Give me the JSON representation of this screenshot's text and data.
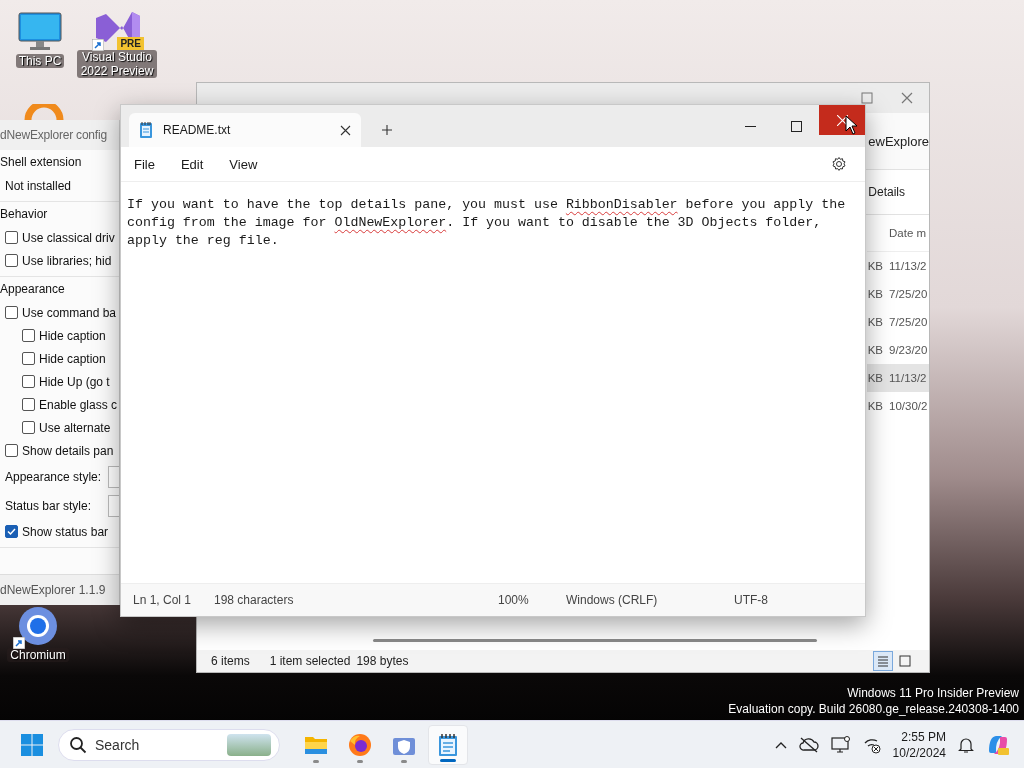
{
  "desktop_icons": [
    {
      "kind": "monitor",
      "label": "This PC",
      "shortcut": false
    },
    {
      "kind": "visual-studio",
      "label": "Visual Studio 2022 Preview",
      "badge": "PRE",
      "shortcut": true
    },
    {
      "kind": "chromium",
      "label": "Chromium",
      "shortcut": true
    }
  ],
  "explorer": {
    "header_text": "ewExplore",
    "view_label": "Details",
    "column": "Date m",
    "rows": [
      {
        "size": "KB",
        "date": "11/13/2",
        "selected": false
      },
      {
        "size": "KB",
        "date": "7/25/20",
        "selected": false
      },
      {
        "size": "KB",
        "date": "7/25/20",
        "selected": false
      },
      {
        "size": "KB",
        "date": "9/23/20",
        "selected": false
      },
      {
        "size": "KB",
        "date": "11/13/2",
        "selected": true
      },
      {
        "size": "KB",
        "date": "10/30/2",
        "selected": false
      }
    ],
    "status": {
      "count": "6 items",
      "selection": "1 item selected",
      "size": "198 bytes"
    },
    "view_modes": [
      {
        "kind": "details",
        "selected": true
      },
      {
        "kind": "tiles",
        "selected": false
      }
    ]
  },
  "config": {
    "title": "dNewExplorer config",
    "sections": [
      {
        "heading": "Shell extension",
        "items": [
          {
            "kind": "text",
            "text": "Not installed"
          }
        ]
      },
      {
        "heading": "Behavior",
        "items": [
          {
            "kind": "checkbox",
            "label": "Use classical driv",
            "checked": false
          },
          {
            "kind": "checkbox",
            "label": "Use libraries; hid",
            "checked": false
          }
        ]
      },
      {
        "heading": "Appearance",
        "items": [
          {
            "kind": "checkbox",
            "label": "Use command ba",
            "checked": false,
            "children": [
              {
                "kind": "checkbox",
                "label": "Hide caption",
                "checked": false
              },
              {
                "kind": "checkbox",
                "label": "Hide caption",
                "checked": false
              },
              {
                "kind": "checkbox",
                "label": "Hide Up (go t",
                "checked": false
              },
              {
                "kind": "checkbox",
                "label": "Enable glass c",
                "checked": false
              },
              {
                "kind": "checkbox",
                "label": "Use alternate",
                "checked": false
              }
            ]
          },
          {
            "kind": "checkbox",
            "label": "Show details pan",
            "checked": false
          },
          {
            "kind": "combo",
            "label": "Appearance style:"
          },
          {
            "kind": "combo",
            "label": "Status bar style:"
          },
          {
            "kind": "checkbox",
            "label": "Show status bar",
            "checked": true
          }
        ]
      }
    ],
    "footer": "dNewExplorer 1.1.9"
  },
  "notepad": {
    "tab": "README.txt",
    "menu": [
      "File",
      "Edit",
      "View"
    ],
    "close_hovered": true,
    "segments": [
      {
        "text": "If you want to have the top details pane, you must use ",
        "misspelled": false
      },
      {
        "text": "RibbonDisabler",
        "misspelled": true
      },
      {
        "text": " before you apply the config from the image for ",
        "misspelled": false
      },
      {
        "text": "OldNewExplorer",
        "misspelled": true
      },
      {
        "text": ". If you want to disable the 3D Objects folder, apply the reg file.",
        "misspelled": false
      }
    ],
    "status": [
      "Ln 1, Col 1",
      "198 characters",
      "100%",
      "Windows (CRLF)",
      "UTF-8"
    ]
  },
  "watermark": [
    "Windows 11 Pro Insider Preview",
    "Evaluation copy. Build 26080.ge_release.240308-1400"
  ],
  "taskbar": {
    "search_placeholder": "Search",
    "apps": [
      {
        "kind": "file-explorer",
        "running": true,
        "active": false
      },
      {
        "kind": "firefox",
        "running": true,
        "active": false
      },
      {
        "kind": "security",
        "running": true,
        "active": false
      },
      {
        "kind": "notepad",
        "running": true,
        "active": true
      }
    ],
    "time": "2:55 PM",
    "date": "10/2/2024"
  }
}
